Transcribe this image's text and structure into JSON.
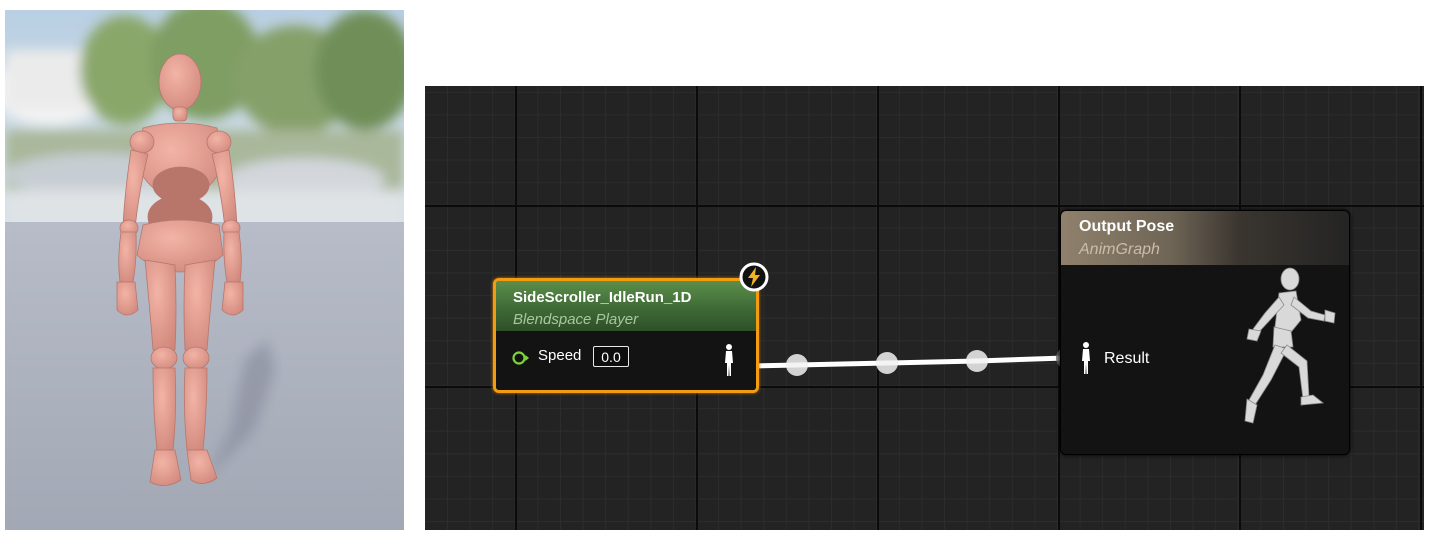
{
  "viewport": {
    "scene": "mannequin-preview"
  },
  "blendspace_node": {
    "title": "SideScroller_IdleRun_1D",
    "subtitle": "Blendspace Player",
    "pin_label": "Speed",
    "pin_value": "0.0",
    "header_color": "#4a7a3f",
    "selection_color": "#f39c12"
  },
  "output_node": {
    "title": "Output Pose",
    "subtitle": "AnimGraph",
    "pin_label": "Result",
    "header_color": "#8f816c"
  },
  "colors": {
    "graph_background": "#232323",
    "wire": "#ffffff",
    "float_pin": "#7cd33a"
  },
  "icons": [
    "lightning-bolt-icon",
    "pose-pin-icon",
    "float-pin-icon",
    "running-mannequin-icon"
  ]
}
